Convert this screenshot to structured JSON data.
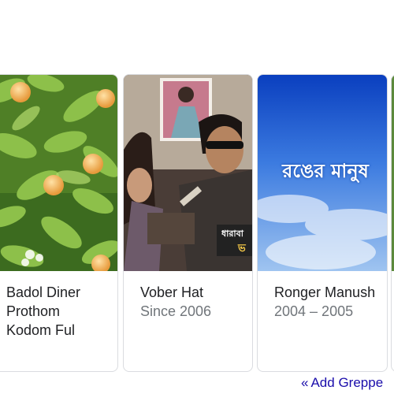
{
  "cards": [
    {
      "title": "Badol Diner Prothom Kodom Ful",
      "subtitle": ""
    },
    {
      "title": "Vober Hat",
      "subtitle": "Since 2006"
    },
    {
      "title": "Ronger Manush",
      "subtitle": "2004 – 2005"
    }
  ],
  "poster_text": {
    "ronger": "রঙের মানুষ",
    "vober_overlay": "ধারাবা\nভ"
  },
  "footer": {
    "add_prefix": "«",
    "add_label": "Add Greppe"
  }
}
